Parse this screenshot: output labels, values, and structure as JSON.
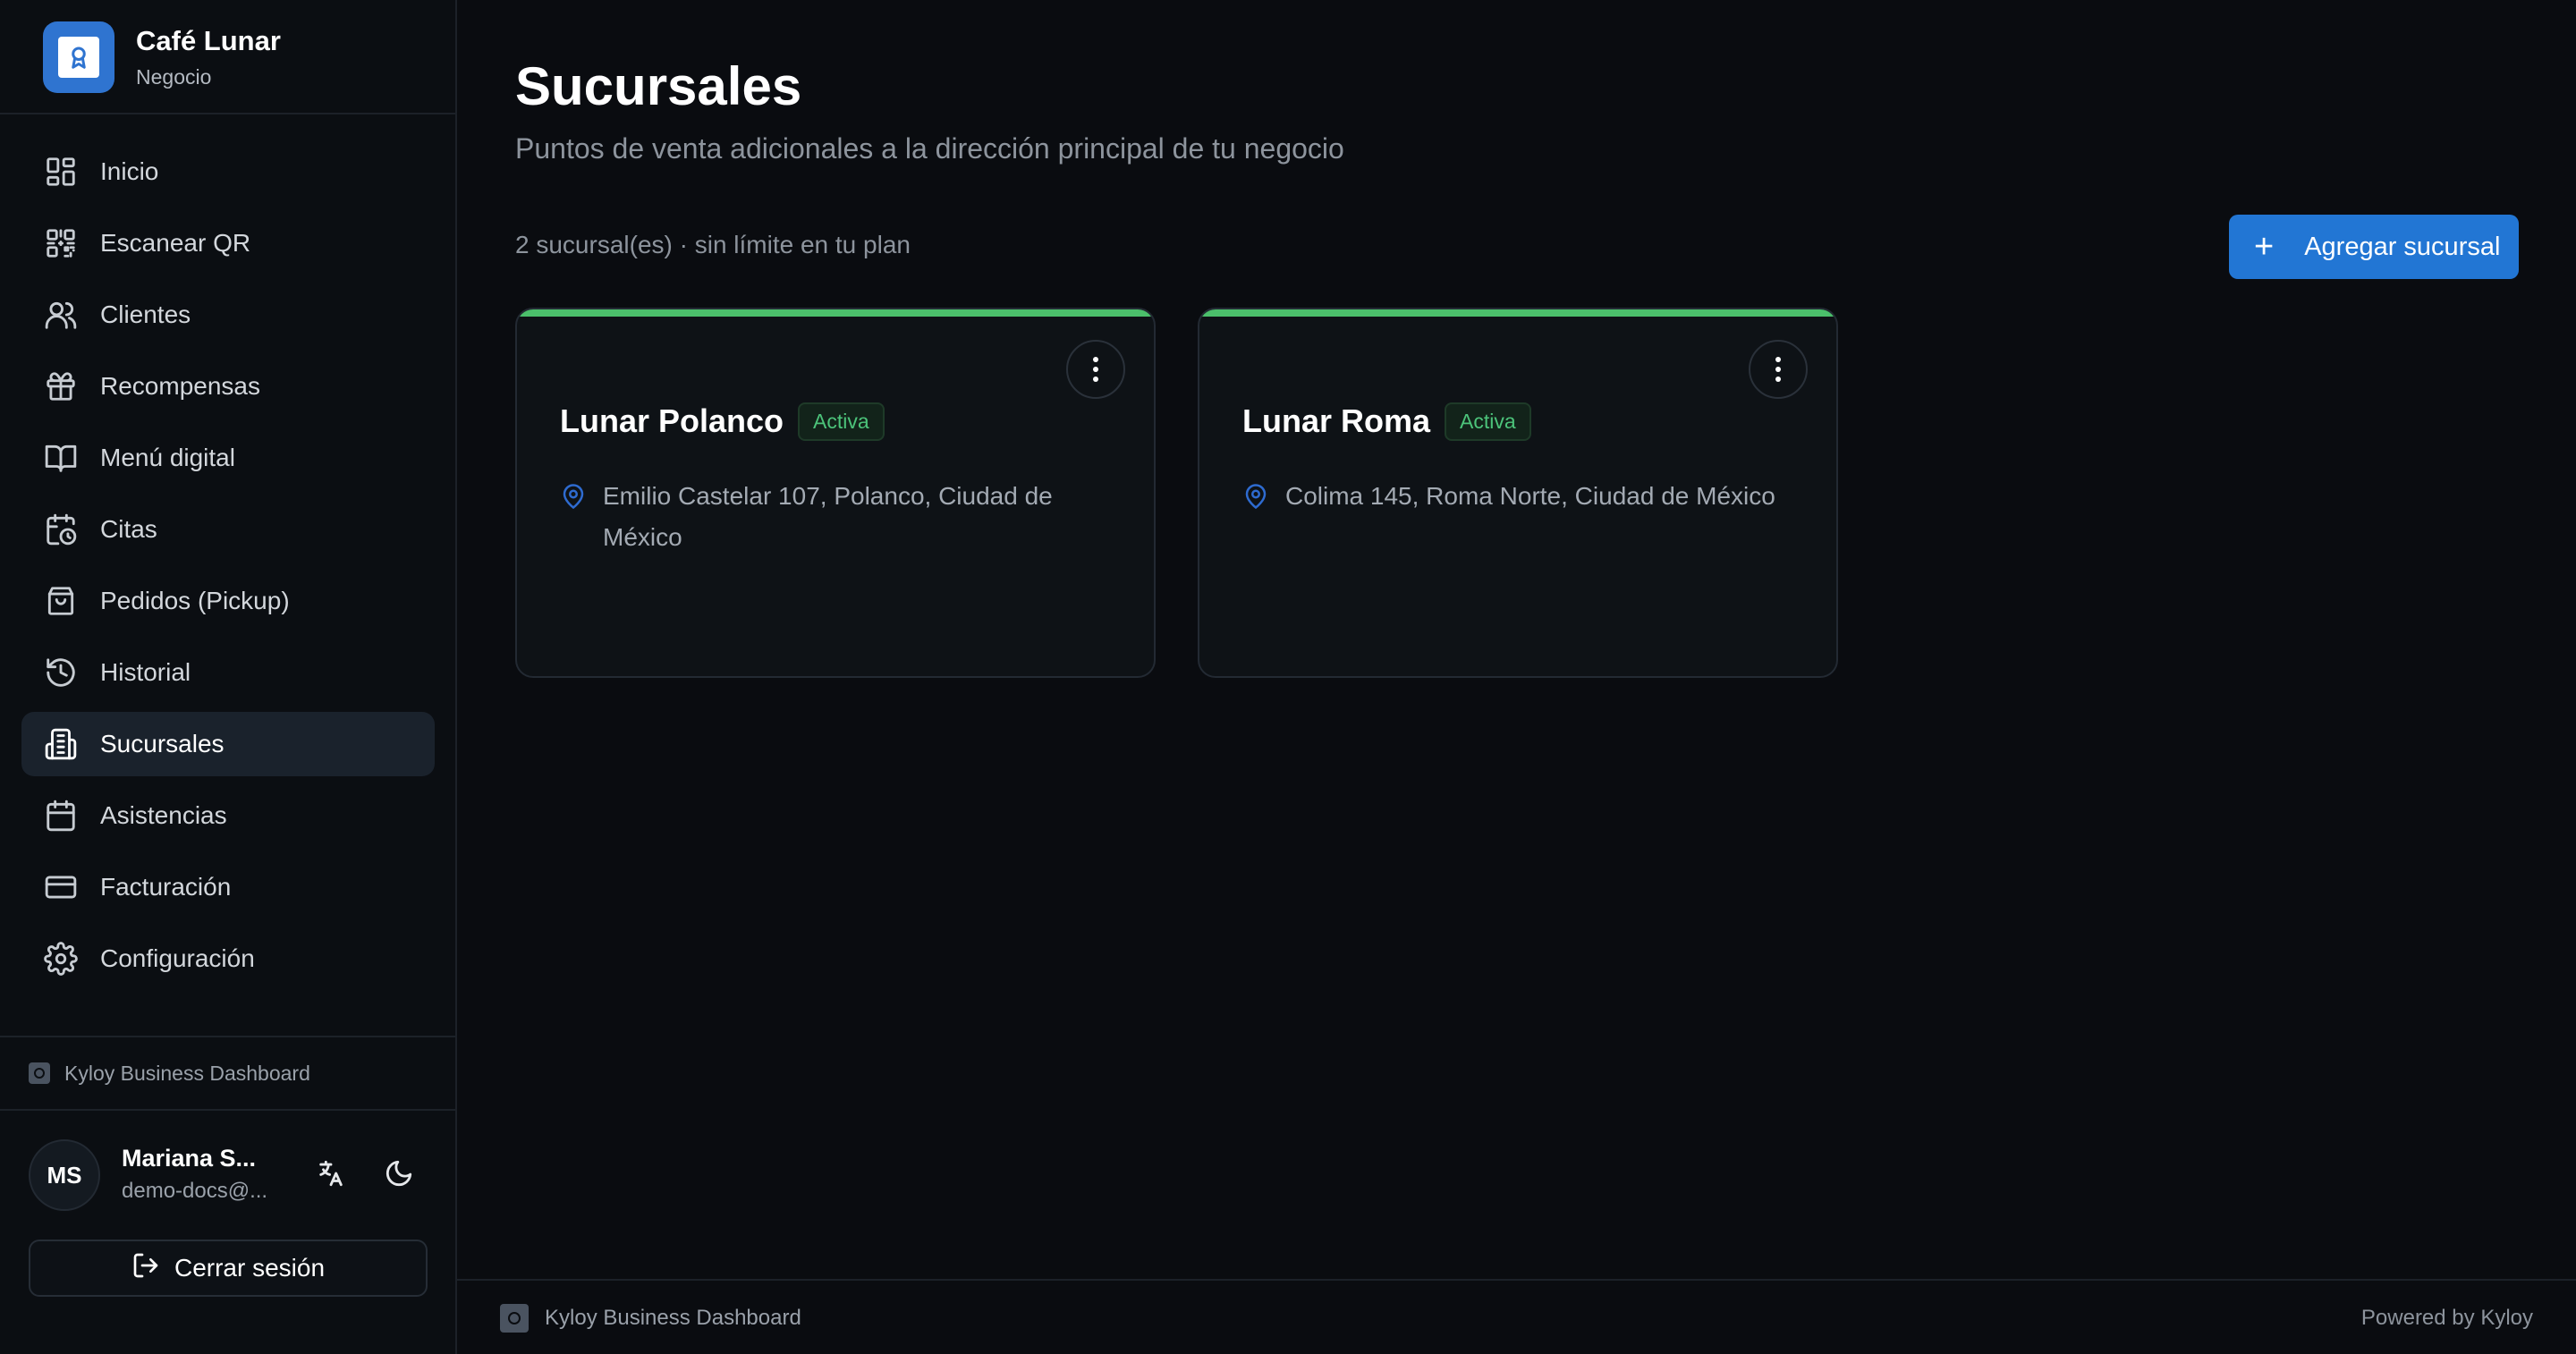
{
  "brand": {
    "name": "Café Lunar",
    "subtitle": "Negocio"
  },
  "sidebar": {
    "items": [
      {
        "label": "Inicio",
        "icon": "dashboard-icon",
        "active": false
      },
      {
        "label": "Escanear QR",
        "icon": "qr-code-icon",
        "active": false
      },
      {
        "label": "Clientes",
        "icon": "users-icon",
        "active": false
      },
      {
        "label": "Recompensas",
        "icon": "gift-icon",
        "active": false
      },
      {
        "label": "Menú digital",
        "icon": "book-open-icon",
        "active": false
      },
      {
        "label": "Citas",
        "icon": "calendar-clock-icon",
        "active": false
      },
      {
        "label": "Pedidos (Pickup)",
        "icon": "shopping-bag-icon",
        "active": false
      },
      {
        "label": "Historial",
        "icon": "history-icon",
        "active": false
      },
      {
        "label": "Sucursales",
        "icon": "building-icon",
        "active": true
      },
      {
        "label": "Asistencias",
        "icon": "calendar-icon",
        "active": false
      },
      {
        "label": "Facturación",
        "icon": "credit-card-icon",
        "active": false
      },
      {
        "label": "Configuración",
        "icon": "gear-icon",
        "active": false
      }
    ],
    "footer_brand": "Kyloy Business Dashboard"
  },
  "user": {
    "initials": "MS",
    "name": "Mariana S...",
    "email": "demo-docs@...",
    "logout_label": "Cerrar sesión"
  },
  "main": {
    "title": "Sucursales",
    "subtitle": "Puntos de venta adicionales a la dirección principal de tu negocio",
    "count_text": "2 sucursal(es) · sin límite en tu plan",
    "add_button": "Agregar sucursal",
    "branches": [
      {
        "name": "Lunar Polanco",
        "status": "Activa",
        "address": "Emilio Castelar 107, Polanco, Ciudad de México"
      },
      {
        "name": "Lunar Roma",
        "status": "Activa",
        "address": "Colima 145, Roma Norte, Ciudad de México"
      }
    ]
  },
  "footer": {
    "left": "Kyloy Business Dashboard",
    "right": "Powered by Kyloy"
  },
  "colors": {
    "accent": "#2276d4",
    "active_green": "#4bbf6b",
    "background": "#0a0c10"
  }
}
